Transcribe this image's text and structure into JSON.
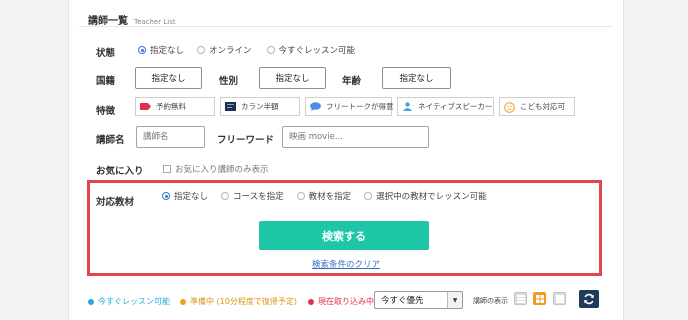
{
  "header": {
    "title": "講師一覧",
    "subtitle": "Teacher List"
  },
  "status": {
    "label": "状態",
    "options": [
      {
        "label": "指定なし",
        "selected": true
      },
      {
        "label": "オンライン",
        "selected": false
      },
      {
        "label": "今すぐレッスン可能",
        "selected": false
      }
    ]
  },
  "nationality": {
    "label": "国籍",
    "value": "指定なし"
  },
  "gender": {
    "label": "性別",
    "value": "指定なし"
  },
  "age": {
    "label": "年齢",
    "value": "指定なし"
  },
  "features": {
    "label": "特徴",
    "items": [
      {
        "label": "予約無料",
        "icon": "ticket-icon"
      },
      {
        "label": "カラン半額",
        "icon": "callan-icon"
      },
      {
        "label": "フリートークが得意",
        "icon": "speech-bubble-icon"
      },
      {
        "label": "ネイティブスピーカー",
        "icon": "native-speaker-icon"
      },
      {
        "label": "こども対応可",
        "icon": "smiley-icon"
      }
    ]
  },
  "teacher_name": {
    "label": "講師名",
    "placeholder": "講師名"
  },
  "freeword": {
    "label": "フリーワード",
    "placeholder": "映画 movie..."
  },
  "favorites": {
    "label": "お気に入り",
    "checkbox_label": "お気に入り講師のみ表示"
  },
  "material": {
    "label": "対応教材",
    "options": [
      {
        "label": "指定なし",
        "selected": true
      },
      {
        "label": "コースを指定",
        "selected": false
      },
      {
        "label": "教材を指定",
        "selected": false
      },
      {
        "label": "選択中の教材でレッスン可能",
        "selected": false
      }
    ]
  },
  "search_button": "検索する",
  "clear_link": "検索条件のクリア",
  "legend": [
    {
      "label": "今すぐレッスン可能",
      "color": "#2aa9e0"
    },
    {
      "label": "準備中 (10分程度で復帰予定)",
      "color": "#f0a020"
    },
    {
      "label": "現在取り込み中",
      "color": "#e0304a"
    }
  ],
  "sort": {
    "value": "今すぐ優先"
  },
  "view_label": "講師の表示",
  "colors": {
    "accent": "#1cc6a6",
    "highlight": "#e2454d",
    "link": "#3a6fc4",
    "refresh": "#1e3c5a",
    "view_active": "#f39a1e"
  }
}
